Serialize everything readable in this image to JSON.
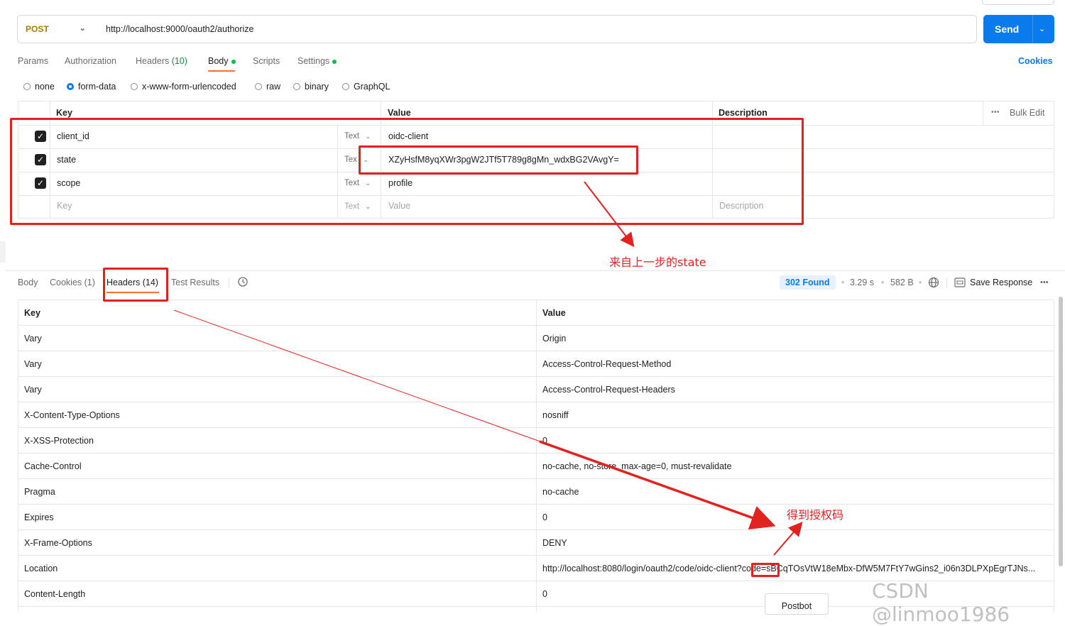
{
  "request": {
    "method": "POST",
    "url": "http://localhost:9000/oauth2/authorize",
    "send_label": "Send"
  },
  "request_tabs": [
    {
      "label": "Params"
    },
    {
      "label": "Authorization"
    },
    {
      "label": "Headers",
      "count": "(10)"
    },
    {
      "label": "Body"
    },
    {
      "label": "Scripts"
    },
    {
      "label": "Settings"
    }
  ],
  "cookies_link": "Cookies",
  "body_types": [
    "none",
    "form-data",
    "x-www-form-urlencoded",
    "raw",
    "binary",
    "GraphQL"
  ],
  "body_type_selected": "form-data",
  "params": {
    "headers": {
      "key": "Key",
      "value": "Value",
      "description": "Description",
      "bulk_edit": "Bulk Edit"
    },
    "rows": [
      {
        "key": "client_id",
        "type": "Text",
        "value": "oidc-client"
      },
      {
        "key": "state",
        "type": "Tex",
        "value": "XZyHsfM8yqXWr3pgW2JTf5T789g8gMn_wdxBG2VAvgY="
      },
      {
        "key": "scope",
        "type": "Text",
        "value": "profile"
      }
    ],
    "placeholder": {
      "key": "Key",
      "type": "Text",
      "value": "Value",
      "description": "Description"
    }
  },
  "response": {
    "tabs": [
      {
        "label": "Body"
      },
      {
        "label": "Cookies (1)"
      },
      {
        "label": "Headers (14)"
      },
      {
        "label": "Test Results"
      }
    ],
    "status": "302 Found",
    "time": "3.29 s",
    "size": "582 B",
    "save_label": "Save Response",
    "headers_table": {
      "key_header": "Key",
      "value_header": "Value",
      "rows": [
        {
          "key": "Vary",
          "value": "Origin"
        },
        {
          "key": "Vary",
          "value": "Access-Control-Request-Method"
        },
        {
          "key": "Vary",
          "value": "Access-Control-Request-Headers"
        },
        {
          "key": "X-Content-Type-Options",
          "value": "nosniff"
        },
        {
          "key": "X-XSS-Protection",
          "value": "0"
        },
        {
          "key": "Cache-Control",
          "value": "no-cache, no-store, max-age=0, must-revalidate"
        },
        {
          "key": "Pragma",
          "value": "no-cache"
        },
        {
          "key": "Expires",
          "value": "0"
        },
        {
          "key": "X-Frame-Options",
          "value": "DENY"
        },
        {
          "key": "Location",
          "value": "http://localhost:8080/login/oauth2/code/oidc-client?code=sBCqTOsVtW18eMbx-DfW5M7FtY7wGins2_i06n3DLPXpEgrTJNs..."
        },
        {
          "key": "Content-Length",
          "value": "0"
        }
      ]
    }
  },
  "postbot_label": "Postbot",
  "annotations": {
    "state_note": "来自上一步的state",
    "code_note": "得到授权码"
  },
  "watermark": "CSDN @linmoo1986",
  "colors": {
    "accent": "#097bed",
    "annotation": "#e3211f",
    "method": "#ad7a03",
    "status_dot": "#0cbb52"
  }
}
